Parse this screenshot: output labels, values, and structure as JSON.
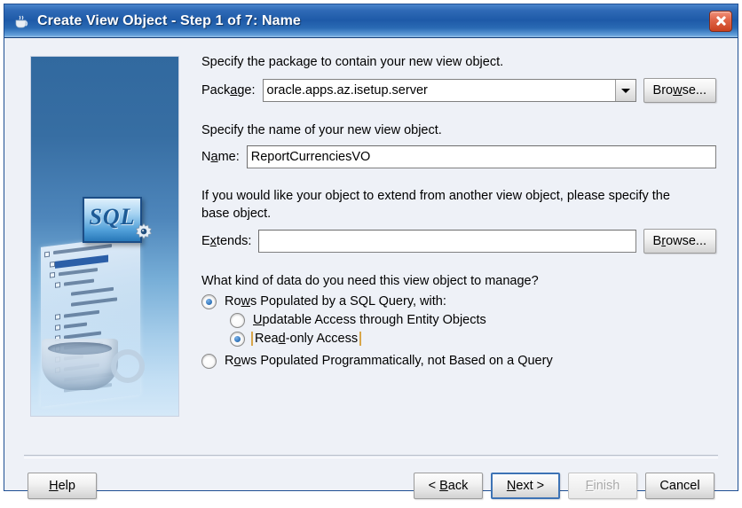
{
  "window": {
    "title": "Create View Object - Step 1 of 7: Name",
    "app_icon": "jdeveloper-coffee-icon",
    "close_icon": "close-icon",
    "titlebar_color": "#1e5aa8",
    "dialog_background": "#eef1f7"
  },
  "side_graphic": {
    "sql_badge_text": "SQL",
    "gear_icon": "gear-icon",
    "cup_icon": "coffee-cup-icon"
  },
  "form": {
    "package_help": "Specify the package to contain your new view object.",
    "package_label_pre": "Pack",
    "package_label_mn": "a",
    "package_label_post": "ge:",
    "package_value": "oracle.apps.az.isetup.server",
    "package_browse_pre": "Bro",
    "package_browse_mn": "w",
    "package_browse_post": "se...",
    "name_help": "Specify the name of your new view object.",
    "name_label_pre": "N",
    "name_label_mn": "a",
    "name_label_post": "me:",
    "name_value": "ReportCurrenciesVO",
    "extends_help": "If you would like your object to extend from another view object, please specify the base object.",
    "extends_label_pre": "E",
    "extends_label_mn": "x",
    "extends_label_post": "tends:",
    "extends_value": "",
    "extends_browse_pre": "B",
    "extends_browse_mn": "r",
    "extends_browse_post": "owse...",
    "kind_question": "What kind of data do you need this view object to manage?",
    "radios": [
      {
        "name": "rows-populated-by-sql-query",
        "pre": "Ro",
        "mn": "w",
        "post": "s Populated by a SQL Query, with:",
        "checked": true,
        "indent": false,
        "focused": false
      },
      {
        "name": "updatable-access-through-entity-objects",
        "pre": "",
        "mn": "U",
        "post": "pdatable Access through Entity Objects",
        "checked": false,
        "indent": true,
        "focused": false
      },
      {
        "name": "read-only-access",
        "pre": "Rea",
        "mn": "d",
        "post": "-only Access",
        "checked": true,
        "indent": true,
        "focused": true
      },
      {
        "name": "rows-populated-programmatically",
        "pre": "R",
        "mn": "o",
        "post": "ws Populated Programmatically, not Based on a Query",
        "checked": false,
        "indent": false,
        "focused": false
      }
    ]
  },
  "buttons": {
    "help_pre": "",
    "help_mn": "H",
    "help_post": "elp",
    "back_pre": "< ",
    "back_mn": "B",
    "back_post": "ack",
    "next_pre": "",
    "next_mn": "N",
    "next_post": "ext >",
    "finish_pre": "",
    "finish_mn": "F",
    "finish_post": "inish",
    "finish_enabled": false,
    "cancel_label": "Cancel",
    "default_button": "next"
  }
}
